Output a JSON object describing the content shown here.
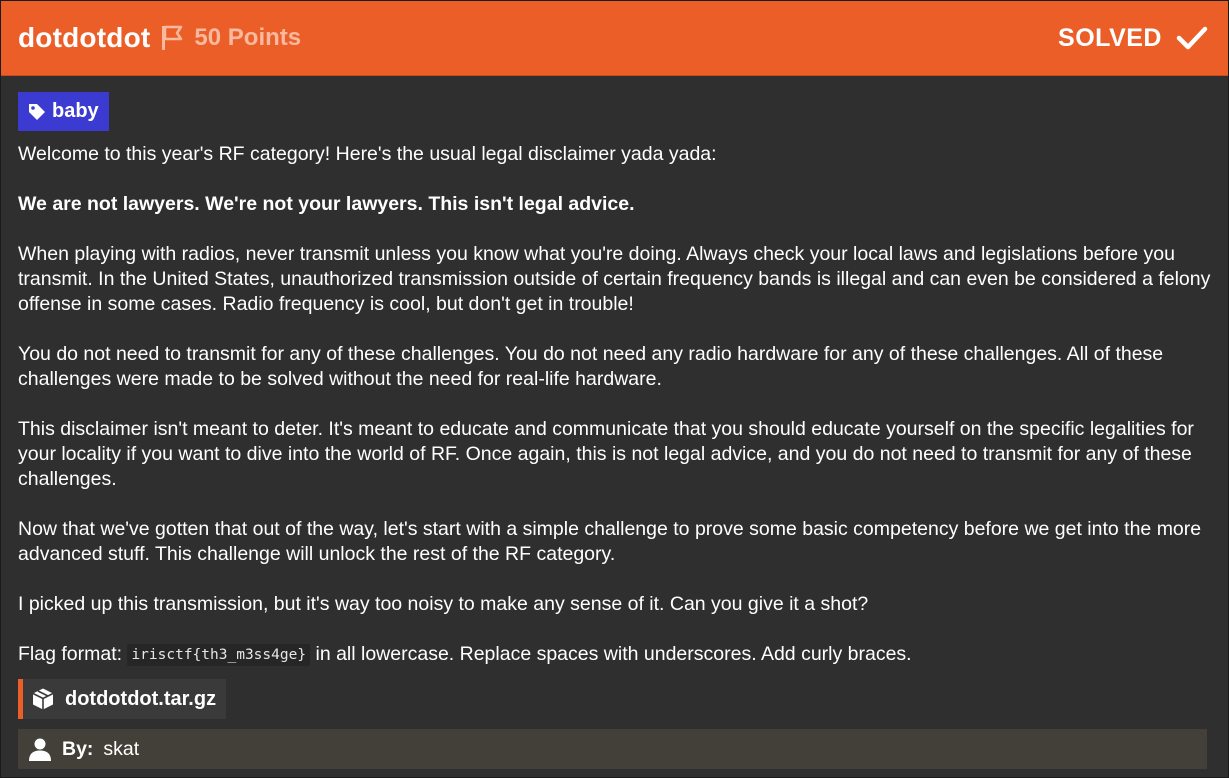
{
  "header": {
    "title": "dotdotdot",
    "points": "50 Points",
    "status": "SOLVED",
    "flag_icon": "flag-icon",
    "check_icon": "check-icon",
    "accent_color": "#ec5e28"
  },
  "tag": {
    "icon": "tag-icon",
    "label": "baby",
    "color": "#3b3bd1"
  },
  "description": {
    "intro": "Welcome to this year's RF category! Here's the usual legal disclaimer yada yada:",
    "disclaimer": "We are not lawyers. We're not your lawyers. This isn't legal advice.",
    "para_radios": "When playing with radios, never transmit unless you know what you're doing. Always check your local laws and legislations before you transmit. In the United States, unauthorized transmission outside of certain frequency bands is illegal and can even be considered a felony offense in some cases. Radio frequency is cool, but don't get in trouble!",
    "para_no_transmit": "You do not need to transmit for any of these challenges. You do not need any radio hardware for any of these challenges. All of these challenges were made to be solved without the need for real-life hardware.",
    "para_deter": "This disclaimer isn't meant to deter. It's meant to educate and communicate that you should educate yourself on the specific legalities for your locality if you want to dive into the world of RF. Once again, this is not legal advice, and you do not need to transmit for any of these challenges.",
    "para_challenge": "Now that we've gotten that out of the way, let's start with a simple challenge to prove some basic competency before we get into the more advanced stuff. This challenge will unlock the rest of the RF category.",
    "para_transmission": "I picked up this transmission, but it's way too noisy to make any sense of it. Can you give it a shot?",
    "flag_format_prefix": "Flag format: ",
    "flag_format_code": "irisctf{th3_m3ss4ge}",
    "flag_format_suffix": " in all lowercase. Replace spaces with underscores. Add curly braces."
  },
  "file": {
    "icon": "package-icon",
    "name": "dotdotdot.tar.gz"
  },
  "author": {
    "icon": "user-icon",
    "label": "By:",
    "name": "skat"
  }
}
